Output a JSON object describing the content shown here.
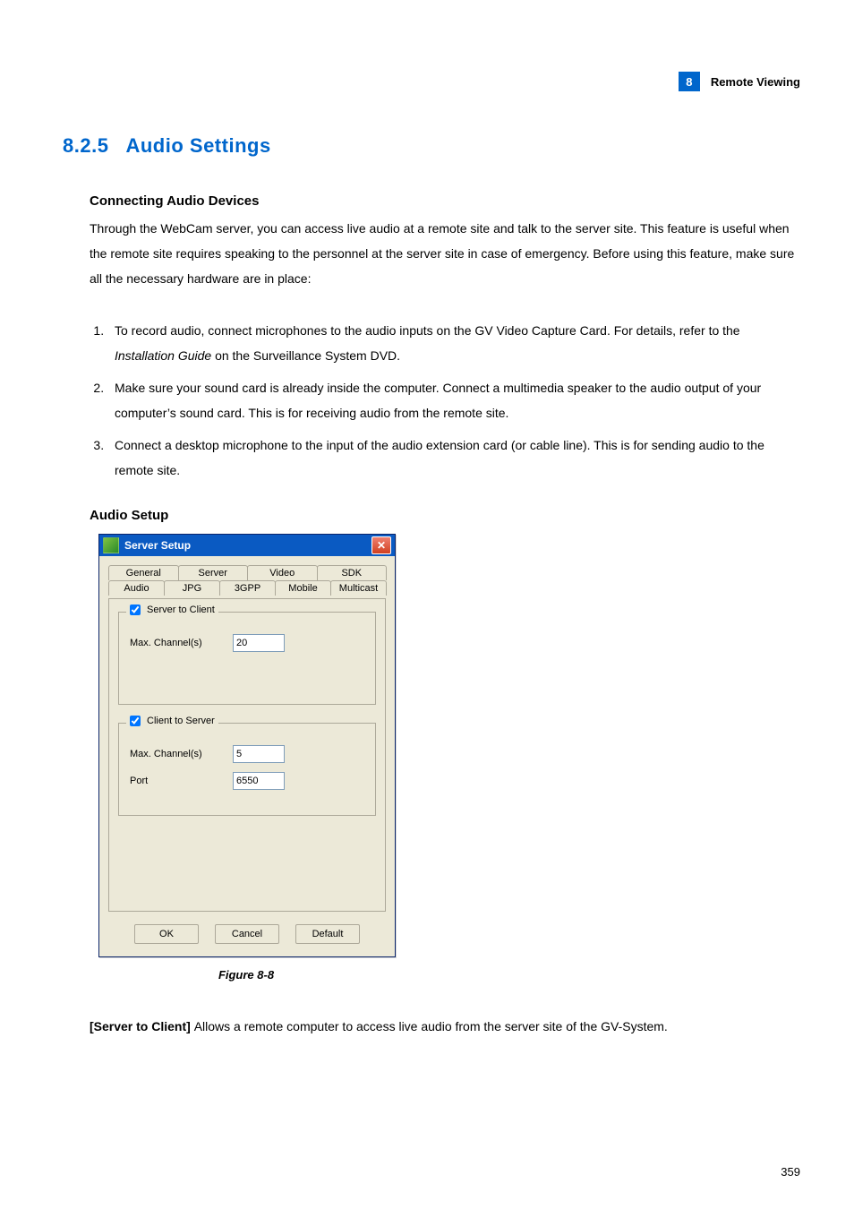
{
  "header": {
    "chapter_number": "8",
    "chapter_title": "Remote Viewing"
  },
  "section": {
    "number": "8.2.5",
    "title": "Audio Settings"
  },
  "connecting": {
    "heading": "Connecting Audio Devices",
    "para": "Through the WebCam server, you can access live audio at a remote site and talk to the server site. This feature is useful when the remote site requires speaking to the personnel at the server site in case of emergency. Before using this feature, make sure all the necessary hardware are in place:",
    "steps": {
      "s1a": "To record audio, connect microphones to the audio inputs on the GV Video Capture Card. For details, refer to the ",
      "s1_italic": "Installation Guide",
      "s1b": " on the Surveillance System DVD.",
      "s2": "Make sure your sound card is already inside the computer. Connect a multimedia speaker to the audio output of your computer’s sound card. This is for receiving audio from the remote site.",
      "s3": "Connect a desktop microphone to the input of the audio extension card (or cable line). This is for sending audio to the remote site."
    }
  },
  "audio_setup": {
    "heading": "Audio Setup"
  },
  "dialog": {
    "title": "Server Setup",
    "close_glyph": "✕",
    "tabs_back": [
      "General",
      "Server",
      "Video",
      "SDK"
    ],
    "tabs_front": [
      "Audio",
      "JPG",
      "3GPP",
      "Mobile",
      "Multicast"
    ],
    "server_to_client": {
      "legend": "Server to Client",
      "max_label": "Max. Channel(s)",
      "max_value": "20"
    },
    "client_to_server": {
      "legend": "Client to Server",
      "max_label": "Max. Channel(s)",
      "max_value": "5",
      "port_label": "Port",
      "port_value": "6550"
    },
    "buttons": {
      "ok": "OK",
      "cancel": "Cancel",
      "default": "Default"
    }
  },
  "figure_caption": "Figure 8-8",
  "definition": {
    "term": "[Server to Client] ",
    "text": "Allows a remote computer to access live audio from the server site of the GV-System."
  },
  "page_number": "359"
}
